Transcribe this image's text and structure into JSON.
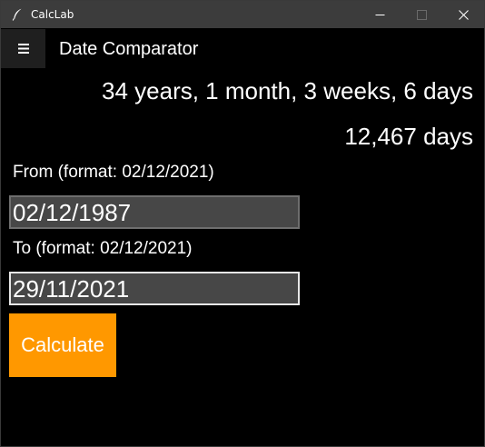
{
  "window": {
    "title": "CalcLab",
    "icon": "feather-icon",
    "controls": [
      "minimize-icon",
      "maximize-icon",
      "close-icon"
    ]
  },
  "header": {
    "menu_icon": "hamburger-menu-icon",
    "title": "Date Comparator"
  },
  "result": {
    "difference": "34 years, 1 month, 3 weeks, 6 days",
    "total_days": "12,467 days"
  },
  "form": {
    "from_label": "From (format: 02/12/2021)",
    "from_value": "02/12/1987",
    "to_label": "To (format: 02/12/2021)",
    "to_value": "29/11/2021",
    "calculate_label": "Calculate"
  },
  "colors": {
    "background": "#000000",
    "titlebar": "#3c3c3c",
    "input_background": "#474747",
    "accent": "#ff9800",
    "text": "#ffffff"
  }
}
